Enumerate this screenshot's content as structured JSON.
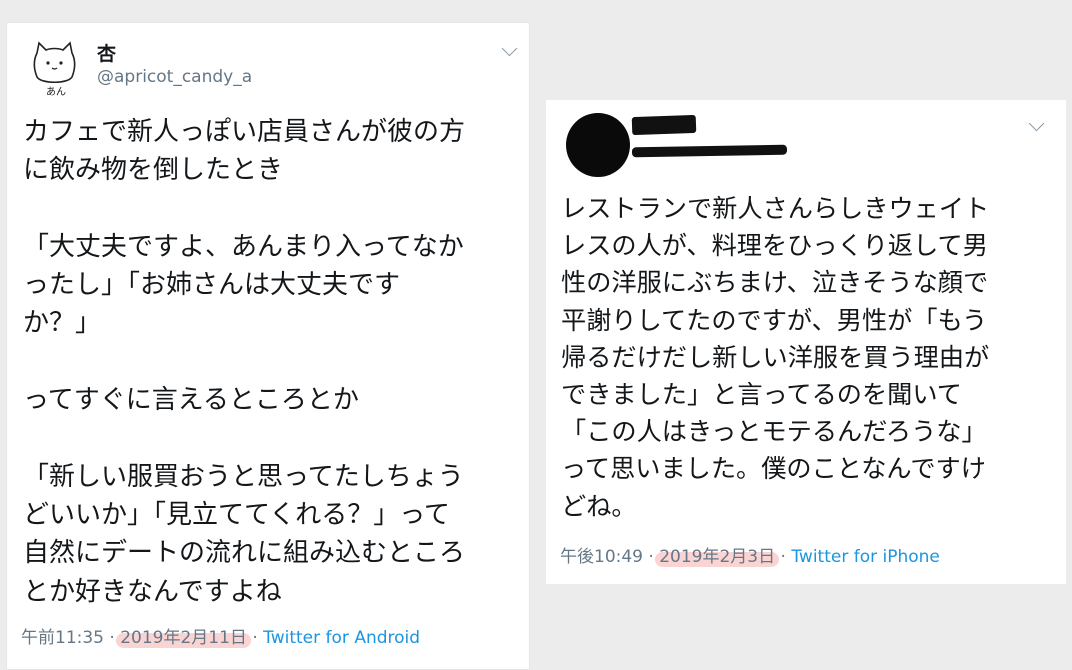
{
  "tweet_left": {
    "display_name": "杏",
    "handle": "@apricot_candy_a",
    "avatar_label": "あん",
    "text": "カフェで新人っぽい店員さんが彼の方\nに飲み物を倒したとき\n\n「大丈夫ですよ、あんまり入ってなか\nったし」「お姉さんは大丈夫です\nか？」\n\nってすぐに言えるところとか\n\n「新しい服買おうと思ってたしちょう\nどいいか」「見立ててくれる？」って\n自然にデートの流れに組み込むところ\nとか好きなんですよね",
    "time": "午前11:35",
    "separator": "·",
    "date": "2019年2月11日",
    "source": "Twitter for Android"
  },
  "tweet_right": {
    "text": "レストランで新人さんらしきウェイト\nレスの人が、料理をひっくり返して男\n性の洋服にぶちまけ、泣きそうな顔で\n平謝りしてたのですが、男性が「もう\n帰るだけだし新しい洋服を買う理由が\nできました」と言ってるのを聞いて\n「この人はきっとモテるんだろうな」\nって思いました。僕のことなんですけ\nどね。",
    "time": "午後10:49",
    "separator": "·",
    "date": "2019年2月3日",
    "source": "Twitter for iPhone"
  },
  "icons": {
    "menu": "chevron-down-icon",
    "avatar_left": "cat-doodle-avatar",
    "avatar_right": "blacked-out-avatar"
  },
  "colors": {
    "text": "#14171a",
    "muted": "#657786",
    "link": "#1b95e0",
    "highlight": "#f08282"
  }
}
